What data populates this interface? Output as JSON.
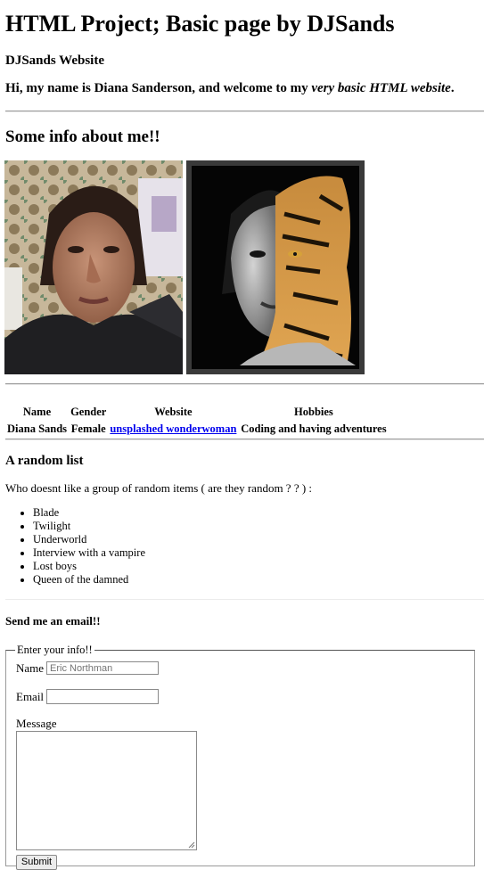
{
  "page": {
    "title": "HTML Project; Basic page by DJSands",
    "site_name": "DJSands Website",
    "intro_prefix": "Hi, my name is Diana Sanderson, and welcome to my ",
    "intro_emph": "very basic HTML website",
    "intro_suffix": "."
  },
  "about": {
    "heading": "Some info about me!!"
  },
  "table": {
    "headers": [
      "Name",
      "Gender",
      "Website",
      "Hobbies"
    ],
    "row": {
      "name": "Diana Sands",
      "gender": "Female",
      "website": "unsplashed wonderwoman",
      "hobbies": "Coding and having adventures"
    }
  },
  "list": {
    "heading": "A random list",
    "intro": "Who doesnt like a group of random items ( are they random ? ? ) :",
    "items": [
      "Blade",
      "Twilight",
      "Underworld",
      "Interview with a vampire",
      "Lost boys",
      "Queen of the damned"
    ]
  },
  "contact": {
    "heading": "Send me an email!!",
    "legend": "Enter your info!!",
    "name_label": "Name",
    "name_placeholder": "Eric Northman",
    "email_label": "Email",
    "message_label": "Message",
    "submit_label": "Submit"
  }
}
